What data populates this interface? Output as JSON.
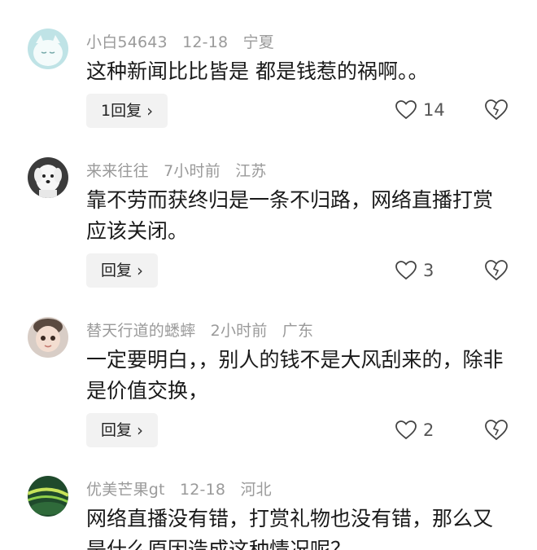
{
  "comments": [
    {
      "user": "小白54643",
      "time": "12-18",
      "location": "宁夏",
      "content": "这种新闻比比皆是 都是钱惹的祸啊。。",
      "reply_label": "1回复",
      "likes": "14"
    },
    {
      "user": "来来往往",
      "time": "7小时前",
      "location": "江苏",
      "content": "靠不劳而获终归是一条不归路，网络直播打赏应该关闭。",
      "reply_label": "回复",
      "likes": "3"
    },
    {
      "user": "替天行道的蟋蟀",
      "time": "2小时前",
      "location": "广东",
      "content": "一定要明白，，别人的钱不是大风刮来的，除非是价值交换，",
      "reply_label": "回复",
      "likes": "2"
    },
    {
      "user": "优美芒果gt",
      "time": "12-18",
      "location": "河北",
      "content": "网络直播没有错，打赏礼物也没有错，那么又是什么原因造成这种情况呢？",
      "reply_label": "",
      "likes": ""
    }
  ],
  "icons": {
    "reply_chevron": "chevron-right-icon",
    "like": "heart-icon",
    "dislike": "broken-heart-icon"
  }
}
